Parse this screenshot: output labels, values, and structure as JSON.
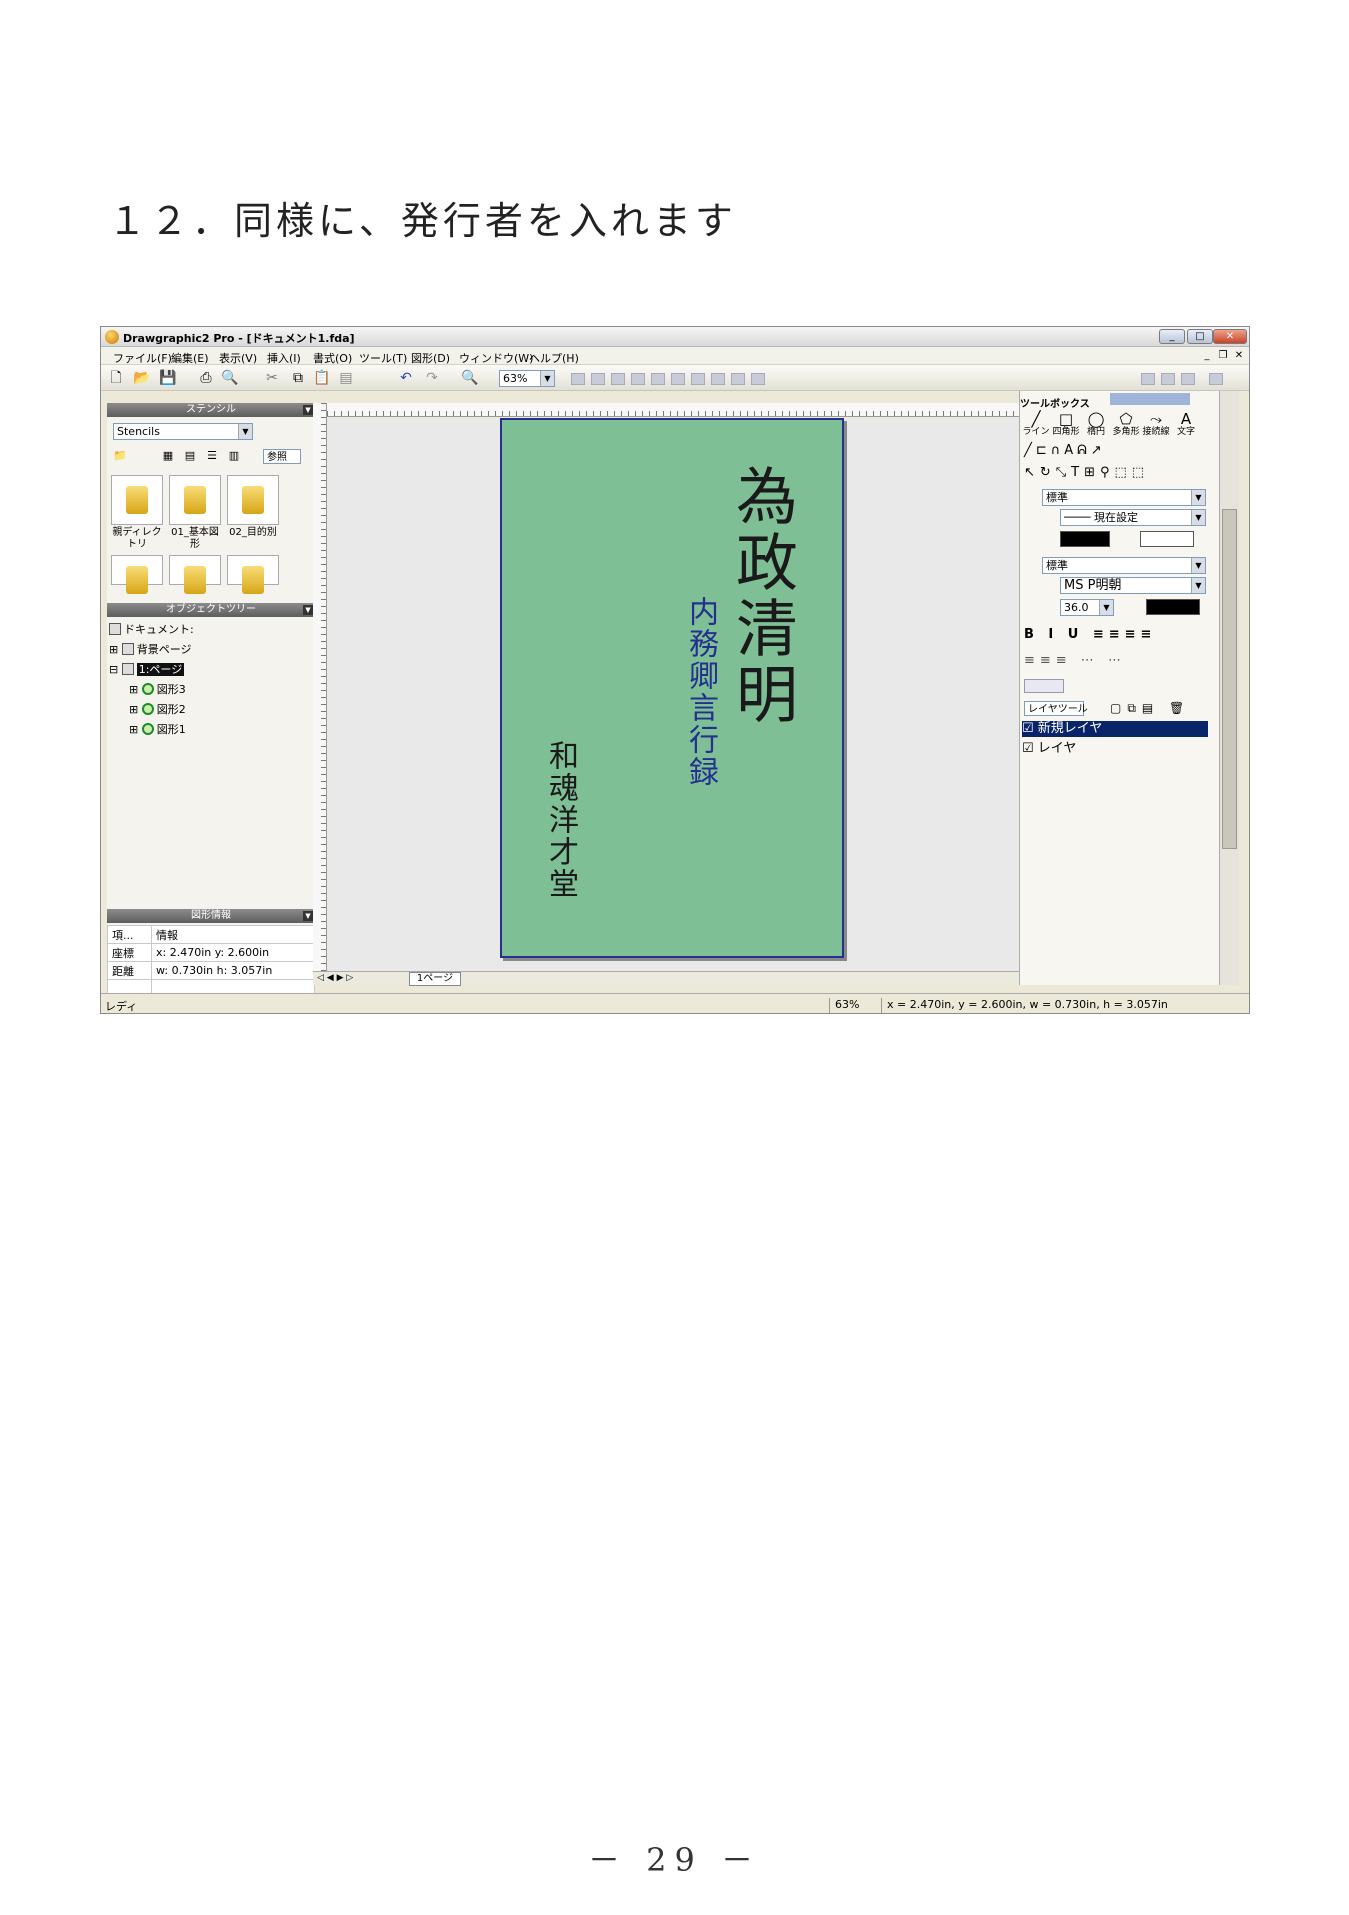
{
  "heading": "１２．同様に、発行者を入れます",
  "page_number": "－ 29 －",
  "window": {
    "title": "Drawgraphic2 Pro - [ドキュメント1.fda]",
    "menu": [
      "ファイル(F)",
      "編集(E)",
      "表示(V)",
      "挿入(I)",
      "書式(O)",
      "ツール(T)",
      "図形(D)",
      "ウィンドウ(W)",
      "ヘルプ(H)"
    ],
    "zoom": "63%"
  },
  "stencil_panel": {
    "header": "ステンシル",
    "dropdown": "Stencils",
    "browse_label": "参照",
    "items": [
      "親ディレクトリ",
      "01_基本図形",
      "02_目的別"
    ]
  },
  "object_tree": {
    "header": "オブジェクトツリー",
    "root": "ドキュメント:",
    "background": "背景ページ",
    "page": "1:ページ",
    "shapes": [
      "図形3",
      "図形2",
      "図形1"
    ]
  },
  "shape_info": {
    "header": "図形情報",
    "columns": [
      "項...",
      "情報"
    ],
    "rows": [
      [
        "座標",
        "x: 2.470in y: 2.600in"
      ],
      [
        "距離",
        "w: 0.730in h: 3.057in"
      ]
    ]
  },
  "document": {
    "title_text": "為政清明",
    "subtitle_text": "内務卿言行録",
    "publisher_text": "和魂洋才堂"
  },
  "page_tab": "1ページ",
  "toolbox": {
    "header": "ツールボックス",
    "tools": [
      "ライン",
      "四角形",
      "楕円",
      "多角形",
      "接続線",
      "文字"
    ],
    "line_style": "標準",
    "line_setting": "現在設定",
    "text_style": "標準",
    "font": "MS P明朝",
    "font_size": "36.0",
    "layer_menu": "レイヤツール",
    "layers": [
      "新規レイヤ",
      "レイヤ"
    ]
  },
  "status": {
    "left": "レディ",
    "zoom": "63%",
    "coords": "x = 2.470in, y = 2.600in, w = 0.730in, h = 3.057in"
  },
  "colors": {
    "paper": "#7fbf95",
    "paper_border": "#25308f",
    "subtitle": "#24308f",
    "selection": "#0a246a"
  }
}
